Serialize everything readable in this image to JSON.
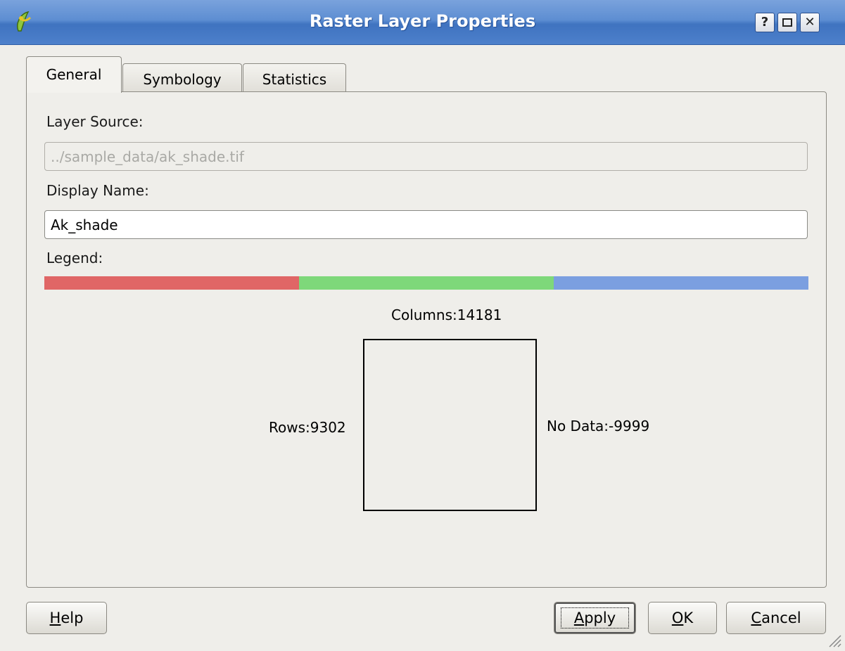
{
  "window": {
    "title": "Raster Layer Properties",
    "controls": {
      "help": "?",
      "close": "✕"
    }
  },
  "tabs": [
    {
      "label": "General",
      "active": true
    },
    {
      "label": "Symbology",
      "active": false
    },
    {
      "label": "Statistics",
      "active": false
    }
  ],
  "general": {
    "layer_source_label": "Layer Source:",
    "layer_source_value": "../sample_data/ak_shade.tif",
    "display_name_label": "Display Name:",
    "display_name_value": "Ak_shade",
    "legend_label": "Legend:",
    "legend_colors": [
      "#e06666",
      "#7ed87a",
      "#7b9fe0"
    ],
    "columns": "Columns:14181",
    "rows": "Rows:9302",
    "no_data": "No Data:-9999"
  },
  "buttons": {
    "help_pre": "",
    "help_ul": "H",
    "help_post": "elp",
    "apply_ul": "A",
    "apply_post": "pply",
    "ok_ul": "O",
    "ok_post": "K",
    "cancel_ul": "C",
    "cancel_post": "ancel"
  }
}
